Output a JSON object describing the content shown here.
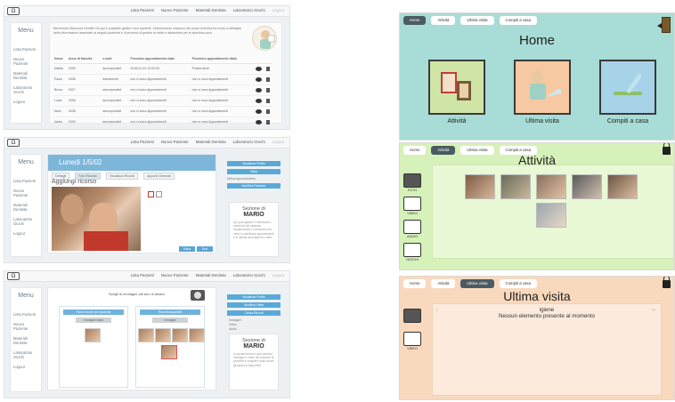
{
  "doctor": {
    "logo": "Ω",
    "nav": [
      "Lista Pazienti",
      "Nuovo Paziente",
      "Materiali Dentista",
      "Laboratorio Giochi",
      "Logout"
    ],
    "menu_title": "Menu",
    "menu_items": [
      "Lista Pazienti",
      "Nuovo Paziente",
      "Materiali Dentista",
      "Laboratorio Giochi",
      "Logout"
    ],
    "intro_text": "Benvenuto Marcuola Gentile! Da qui è possibile gestire i tuoi pazienti. Selezionando ciascuno dei propri individui ha modo a dettaglio delle informazioni associate al singolo paziente e il percorso di gestire le visite e attuazione per le specifica cura.",
    "table": {
      "headers": [
        "Nome",
        "Anno di Nascita",
        "e-mail",
        "Prossimo appuntamento data",
        "Prossimo appuntamento titolo"
      ],
      "rows": [
        [
          "Mattia",
          "2009",
          "amcorporativi",
          "2018-01-02 10:00:00",
          "Pulizia denti"
        ],
        [
          "Paolo",
          "2006",
          "Ifantamenti",
          "non ci sono Appuntamenti",
          "non ci sono Appuntamenti"
        ],
        [
          "Bruno",
          "2007",
          "amcorporativi",
          "non ci sono Appuntamenti",
          "non ci sono Appuntamenti"
        ],
        [
          "Lucia",
          "2006",
          "amcorporativi",
          "non ci sono Appuntamenti",
          "non ci sono Appuntamenti"
        ],
        [
          "Ilario",
          "2008",
          "amcorporativi",
          "non ci sono Appuntamenti",
          "non ci sono Appuntamenti"
        ],
        [
          "Ianira",
          "2009",
          "amcorporativi",
          "non ci sono Appuntamenti",
          "non ci sono Appuntamenti"
        ]
      ]
    },
    "p2": {
      "header": "Lunedi 1/5/02",
      "tabs": [
        "Dettagli",
        "Foto Ricordo",
        "Visualizza Ricordi",
        "Appunti Generali"
      ],
      "subtitle": "Aggiungi ricorso",
      "buttons": [
        "Salva",
        "Esci"
      ],
      "side_buttons": [
        "Visualizza Profilo",
        "Visita",
        "Modifica Paziente"
      ],
      "side_text": "Ultimo appuntamento",
      "section_title": "Sezione di",
      "section_name": "MARIO",
      "section_text": "Qui puoi gestire e monitorare i contenuti del paziente visualizzando e caricando foto, video e pianificare appuntamenti e le attività da svolgere a casa."
    },
    "p3": {
      "title": "Scegli le immagini dal box di destra",
      "col_left_btn": "Ricevi ricordi per paziente",
      "col_left_sub": "Immagini visita",
      "col_right_btn": "Ricordi disponibili",
      "col_right_sub": "Immagini",
      "side_buttons": [
        "Visualizza Profilo",
        "Modifica Visita",
        "Carica Ricordi"
      ],
      "side_list": [
        "Immagini",
        "Video",
        "Audio"
      ],
      "section_title": "Sezione di",
      "section_name": "MARIO",
      "section_text": "In questa sezione puoi caricare immagini e video da mostrare al paziente e scegliere quali ricordi gli saranno disponibili."
    }
  },
  "child": {
    "tabs": [
      "Home",
      "Attività",
      "Ultima visita",
      "Compiti a casa"
    ],
    "home": {
      "title": "Home",
      "tiles": [
        "Attività",
        "Ultima visita",
        "Compiti a casa"
      ]
    },
    "att": {
      "title": "Attività",
      "side": [
        "FOTO",
        "VIDEO",
        "AUDIO",
        "GIOCHI"
      ]
    },
    "uv": {
      "title": "Ultima visita",
      "visit_title": "igiene",
      "visit_msg": "Nessun elemento presente al momento",
      "side": [
        "FOTO",
        "VIDEO"
      ]
    }
  },
  "colors": {
    "home_bg": "#a8dcd6",
    "att_bg": "#d6f1b9",
    "uv_bg": "#f9d9bd",
    "doctor_blue": "#7eb6da",
    "active_tab": "#4b5b62"
  }
}
